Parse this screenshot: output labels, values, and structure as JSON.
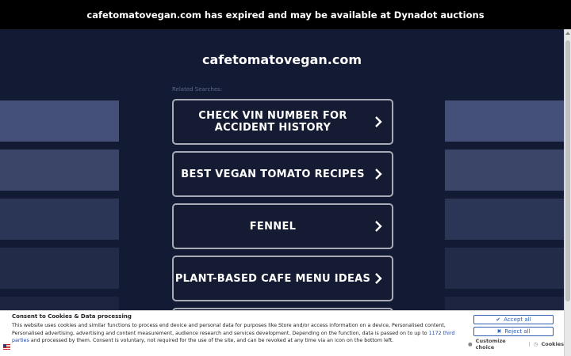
{
  "banner": {
    "text": "cafetomatovegan.com has expired and may be available at Dynadot auctions"
  },
  "domain_title": "cafetomatovegan.com",
  "related_label": "Related Searches:",
  "searches": [
    {
      "line1": "CHECK VIN NUMBER FOR",
      "line2": "ACCIDENT HISTORY"
    },
    {
      "line1": "BEST VEGAN TOMATO RECIPES",
      "line2": ""
    },
    {
      "line1": "FENNEL",
      "line2": ""
    },
    {
      "line1": "PLANT-BASED CAFE MENU IDEAS",
      "line2": ""
    }
  ],
  "cookie": {
    "title": "Consent to Cookies & Data processing",
    "text_before": "This website uses cookies and similar functions to process end device and personal data for purposes like Store and/or access information on a device, Personalised content, Personalised advertising, advertising and content measurement, audience research and services development. Depending on the function, data is passed on to up to ",
    "link": "1172 third parties",
    "text_after": " and processed by them. Consent is voluntary, not required for the use of the site, and can be revoked at any time via an icon on the bottom left.",
    "accept_label": "Accept all",
    "reject_label": "Reject all",
    "customize_label": "Customize choice",
    "separator": "|",
    "cookies_label": "Cookies"
  },
  "colors": {
    "background": "#131a33",
    "banner": "#000000",
    "button_border": "#a8abb5",
    "cookie_accent": "#2e5fb3"
  }
}
